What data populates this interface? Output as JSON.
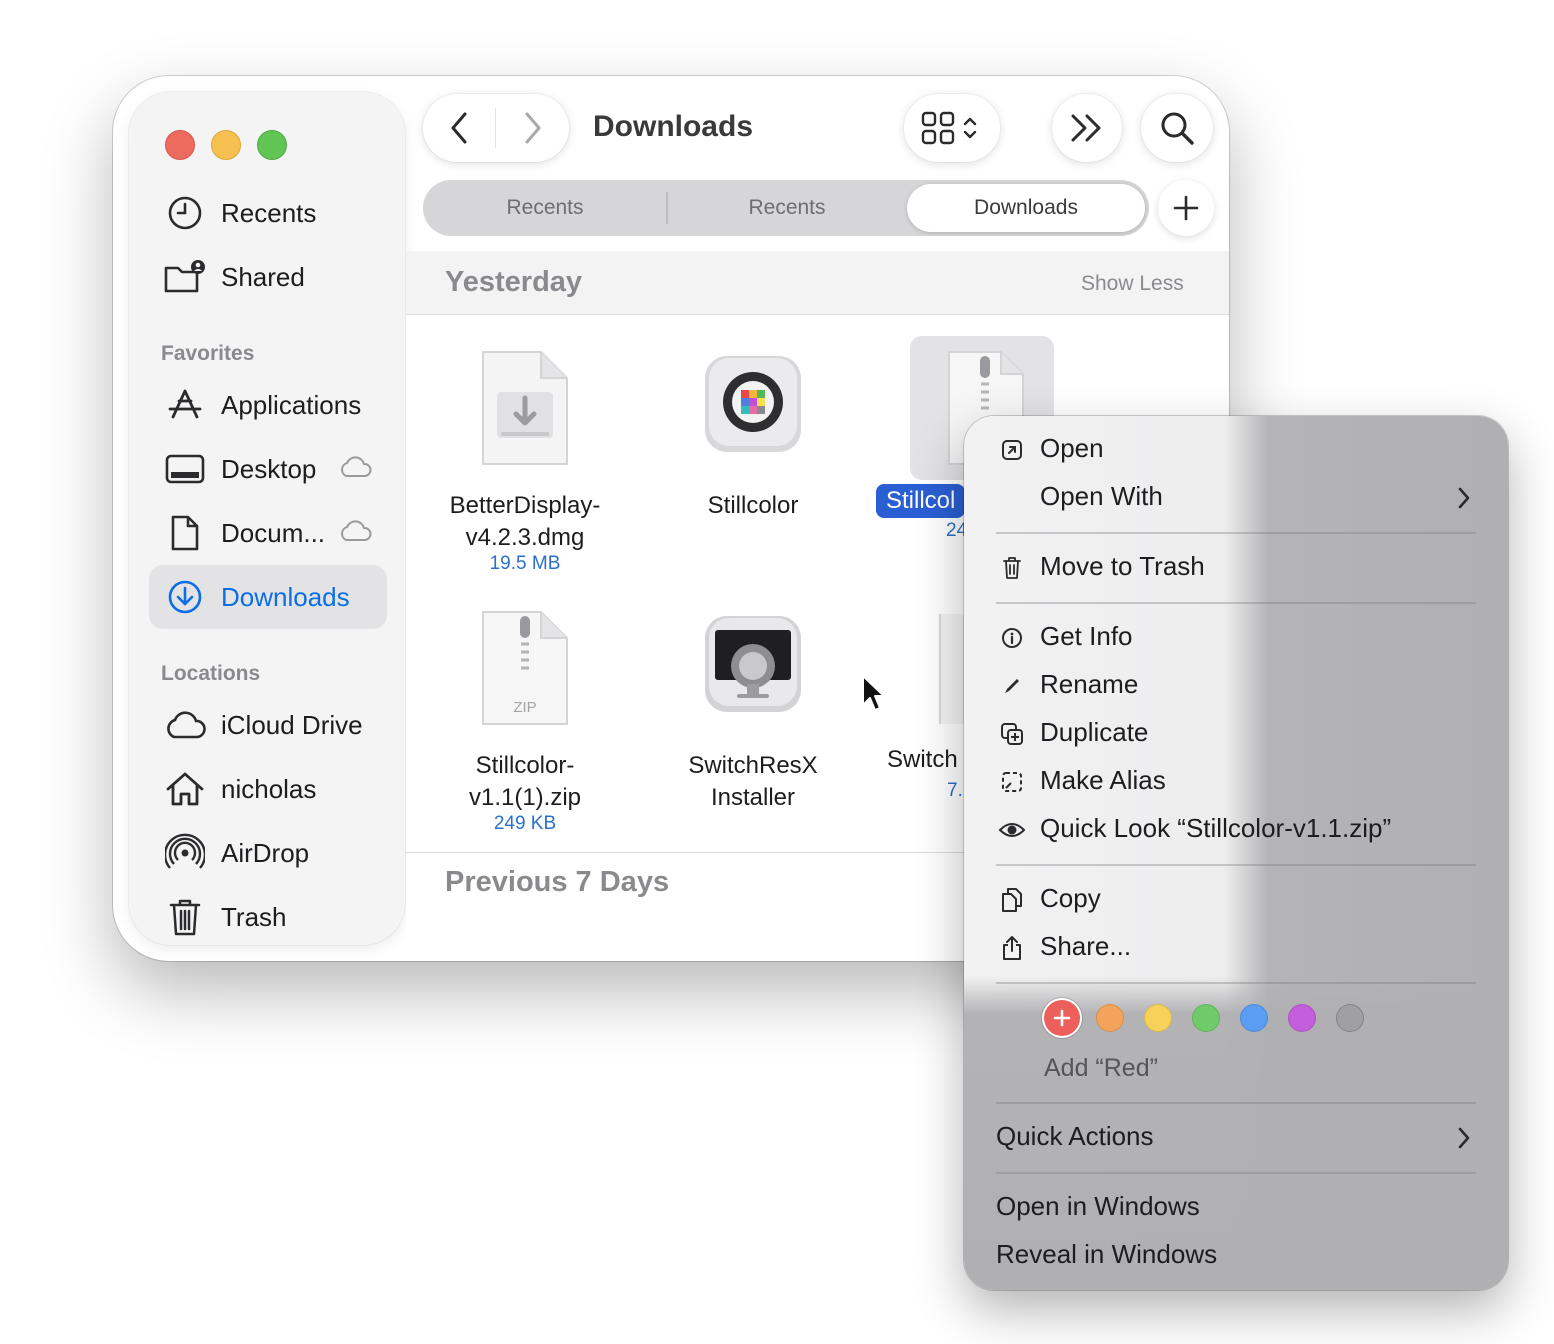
{
  "window": {
    "title": "Downloads"
  },
  "sidebar": {
    "top_items": [
      {
        "label": "Recents",
        "icon": "clock-icon"
      },
      {
        "label": "Shared",
        "icon": "shared-folder-icon"
      }
    ],
    "favorites_heading": "Favorites",
    "favorites": [
      {
        "label": "Applications",
        "icon": "applications-icon"
      },
      {
        "label": "Desktop",
        "icon": "desktop-icon",
        "cloud": true
      },
      {
        "label": "Docum...",
        "icon": "document-icon",
        "cloud": true
      },
      {
        "label": "Downloads",
        "icon": "download-circle-icon",
        "selected": true
      }
    ],
    "locations_heading": "Locations",
    "locations": [
      {
        "label": "iCloud Drive",
        "icon": "cloud-icon"
      },
      {
        "label": "nicholas",
        "icon": "home-icon"
      },
      {
        "label": "AirDrop",
        "icon": "airdrop-icon"
      },
      {
        "label": "Trash",
        "icon": "trash-icon"
      }
    ]
  },
  "tabs": [
    {
      "label": "Recents",
      "active": false
    },
    {
      "label": "Recents",
      "active": false
    },
    {
      "label": "Downloads",
      "active": true
    }
  ],
  "sections": {
    "yesterday": "Yesterday",
    "show_less": "Show Less",
    "previous": "Previous 7 Days"
  },
  "files": [
    {
      "name_line1": "BetterDisplay-",
      "name_line2": "v4.2.3.dmg",
      "size": "19.5 MB",
      "icon": "dmg-file-icon"
    },
    {
      "name_line1": "Stillcolor",
      "name_line2": "",
      "size": "",
      "icon": "stillcolor-app-icon"
    },
    {
      "name_line1": "Stillcol",
      "name_line2": "",
      "size": "24",
      "icon": "zip-file-icon",
      "selected": true
    },
    {
      "name_line1": "Stillcolor-",
      "name_line2": "v1.1(1).zip",
      "size": "249 KB",
      "icon": "zip-file-icon",
      "badge": "ZIP"
    },
    {
      "name_line1": "SwitchResX",
      "name_line2": "Installer",
      "size": "",
      "icon": "switchresx-installer-icon"
    },
    {
      "name_line1": "Switch",
      "name_line2": "",
      "size": "7.",
      "icon": "file-icon"
    }
  ],
  "context_menu": {
    "items": {
      "open": "Open",
      "open_with": "Open With",
      "move_to_trash": "Move to Trash",
      "get_info": "Get Info",
      "rename": "Rename",
      "duplicate": "Duplicate",
      "make_alias": "Make Alias",
      "quick_look": "Quick Look “Stillcolor-v1.1.zip”",
      "copy": "Copy",
      "share": "Share...",
      "add_tag": "Add “Red”",
      "quick_actions": "Quick Actions",
      "open_in_windows": "Open in Windows",
      "reveal_in_windows": "Reveal in Windows"
    },
    "tag_colors": [
      "#ec5f5b",
      "#f3a45a",
      "#f7d25a",
      "#6fcb6a",
      "#5b9df3",
      "#c35fdc",
      "#a0a0a3"
    ]
  }
}
